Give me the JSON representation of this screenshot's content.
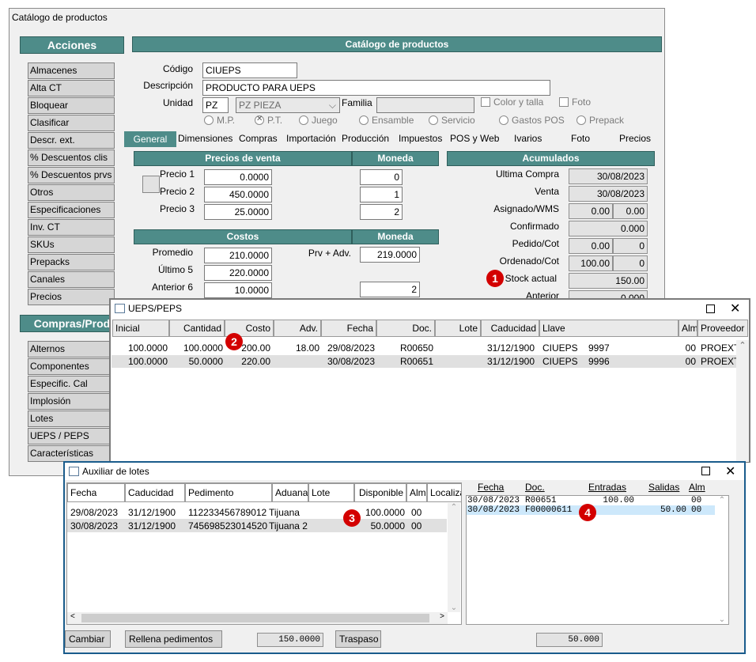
{
  "main_window": {
    "title": "Catálogo de productos",
    "header": "Catálogo de productos",
    "acciones_header": "Acciones",
    "acciones": [
      "Almacenes",
      "Alta CT",
      "Bloquear",
      "Clasificar",
      "Descr. ext.",
      "% Descuentos clis",
      "% Descuentos prvs",
      "Otros",
      "Especificaciones",
      "Inv. CT",
      "SKUs",
      "Prepacks",
      "Canales",
      "Precios"
    ],
    "compras_header": "Compras/Prod",
    "compras": [
      "Alternos",
      "Componentes",
      "Especific. Cal",
      "Implosión",
      "Lotes",
      "UEPS / PEPS",
      "Características"
    ],
    "codigo_label": "Código",
    "codigo_value": "CIUEPS",
    "descripcion_label": "Descripción",
    "descripcion_value": "PRODUCTO PARA UEPS",
    "unidad_label": "Unidad",
    "unidad_value": "PZ",
    "unidad_select": "PZ  PIEZA",
    "familia_label": "Familia",
    "color_talla": "Color y talla",
    "foto_chk": "Foto",
    "radios": [
      "M.P.",
      "P.T.",
      "Juego",
      "Ensamble",
      "Servicio",
      "Gastos POS",
      "Prepack"
    ],
    "tabs": [
      "General",
      "Dimensiones",
      "Compras",
      "Importación",
      "Producción",
      "Impuestos",
      "POS y Web",
      "Ivarios",
      "Foto",
      "Precios"
    ],
    "precios_header": "Precios de venta",
    "moneda_header": "Moneda",
    "precios": [
      {
        "label": "Precio 1",
        "value": "0.0000",
        "moneda": "0"
      },
      {
        "label": "Precio 2",
        "value": "450.0000",
        "moneda": "1"
      },
      {
        "label": "Precio 3",
        "value": "25.0000",
        "moneda": "2"
      }
    ],
    "costos_header": "Costos",
    "costos_moneda_header": "Moneda",
    "costos": [
      {
        "label": "Promedio",
        "value": "210.0000"
      },
      {
        "label": "Último 5",
        "value": "220.0000"
      },
      {
        "label": "Anterior 6",
        "value": "10.0000"
      }
    ],
    "prv_adv_label": "Prv + Adv.",
    "prv_adv_value": "219.0000",
    "costos_moneda_value": "2",
    "acumulados_header": "Acumulados",
    "ultima_compra_label": "Ultima  Compra",
    "ultima_compra_value": "30/08/2023",
    "venta_label": "Venta",
    "venta_value": "30/08/2023",
    "asignado_label": "Asignado/WMS",
    "asignado_a": "0.00",
    "asignado_b": "0.00",
    "confirmado_label": "Confirmado",
    "confirmado_value": "0.000",
    "pedido_label": "Pedido/Cot",
    "pedido_a": "0.00",
    "pedido_b": "0",
    "ordenado_label": "Ordenado/Cot",
    "ordenado_a": "100.00",
    "ordenado_b": "0",
    "stock_label": "Stock actual",
    "stock_value": "150.00",
    "anterior_label": "Anterior",
    "anterior_value": "0.000"
  },
  "ueps_window": {
    "title": "UEPS/PEPS",
    "columns": [
      "Inicial",
      "Cantidad",
      "Costo",
      "Adv.",
      "Fecha",
      "Doc.",
      "Lote",
      "Caducidad",
      "Llave",
      "Alm",
      "Proveedor"
    ],
    "rows": [
      {
        "inicial": "100.0000",
        "cantidad": "100.0000",
        "costo": "200.00",
        "adv": "18.00",
        "fecha": "29/08/2023",
        "doc": "R00650",
        "lote": "",
        "caducidad": "31/12/1900",
        "llave": "CIUEPS",
        "llave2": "9997",
        "alm": "00",
        "proveedor": "PROEXT"
      },
      {
        "inicial": "100.0000",
        "cantidad": "50.0000",
        "costo": "220.00",
        "adv": "",
        "fecha": "30/08/2023",
        "doc": "R00651",
        "lote": "",
        "caducidad": "31/12/1900",
        "llave": "CIUEPS",
        "llave2": "9996",
        "alm": "00",
        "proveedor": "PROEXT"
      }
    ]
  },
  "lotes_window": {
    "title": "Auxiliar de lotes",
    "columns": [
      "Fecha",
      "Caducidad",
      "Pedimento",
      "Aduana",
      "Lote",
      "Disponible",
      "Alm",
      "Localiza"
    ],
    "rows": [
      {
        "fecha": "29/08/2023",
        "caducidad": "31/12/1900",
        "pedimento": "112233456789012",
        "aduana": "Tijuana",
        "lote": "",
        "disponible": "100.0000",
        "alm": "00"
      },
      {
        "fecha": "30/08/2023",
        "caducidad": "31/12/1900",
        "pedimento": "745698523014520",
        "aduana": "Tijuana 2",
        "lote": "",
        "disponible": "50.0000",
        "alm": "00"
      }
    ],
    "right_columns": [
      "Fecha",
      "Doc.",
      "Entradas",
      "Salidas",
      "Alm"
    ],
    "right_rows": [
      {
        "fecha": "30/08/2023",
        "doc": "R00651",
        "entradas": "100.00",
        "salidas": "",
        "alm": "00"
      },
      {
        "fecha": "30/08/2023",
        "doc": "F00000611",
        "entradas": "",
        "salidas": "50.00",
        "alm": "00"
      }
    ],
    "btn_cambiar": "Cambiar",
    "btn_rellena": "Rellena pedimentos",
    "total_left": "150.0000",
    "btn_traspaso": "Traspaso",
    "total_right": "50.000"
  },
  "badges": [
    "1",
    "2",
    "3",
    "4"
  ],
  "colors": {
    "accent": "#4e8c89",
    "badge": "#d30000",
    "selected_row": "#cde8fb"
  }
}
